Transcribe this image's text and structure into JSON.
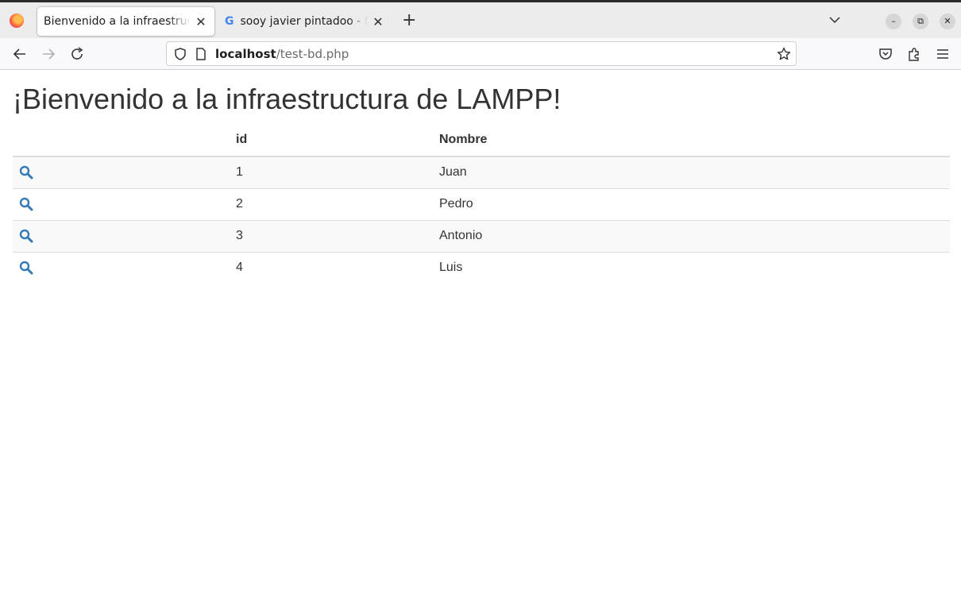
{
  "browser": {
    "tabs": [
      {
        "title": "Bienvenido a la infraestructura de LAMPP!",
        "active": true
      },
      {
        "title": "sooy javier pintadoo - Buscar con Google",
        "active": false
      }
    ],
    "url_host": "localhost",
    "url_path": "/test-bd.php"
  },
  "page": {
    "heading": "¡Bienvenido a la infraestructura de LAMPP!",
    "table": {
      "headers": [
        "",
        "id",
        "Nombre"
      ],
      "rows": [
        {
          "id": "1",
          "nombre": "Juan"
        },
        {
          "id": "2",
          "nombre": "Pedro"
        },
        {
          "id": "3",
          "nombre": "Antonio"
        },
        {
          "id": "4",
          "nombre": "Luis"
        }
      ]
    },
    "link_color": "#337ab7"
  }
}
